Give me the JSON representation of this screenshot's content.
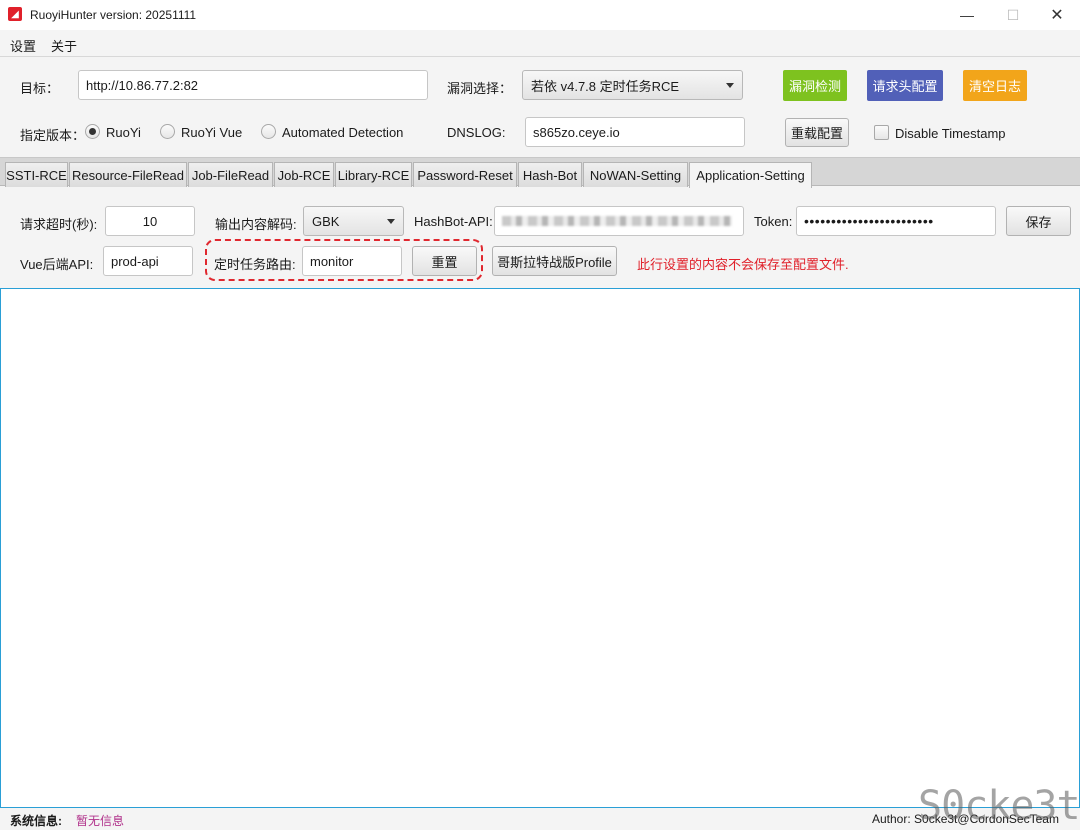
{
  "window": {
    "title": "RuoyiHunter version: 20251111",
    "minimize": "—",
    "maximize": "☐",
    "close": "✕"
  },
  "menu": {
    "items": [
      "设置",
      "关于"
    ]
  },
  "form": {
    "target_label": "目标：",
    "target_value": "http://10.86.77.2:82",
    "vuln_label": "漏洞选择：",
    "vuln_value": "若依 v4.7.8 定时任务RCE",
    "detect_btn": "漏洞检测",
    "header_btn": "请求头配置",
    "clear_btn": "清空日志",
    "version_label": "指定版本：",
    "version_options": [
      "RuoYi",
      "RuoYi Vue",
      "Automated Detection"
    ],
    "version_selected": 0,
    "dnslog_label": "DNSLOG:",
    "dnslog_value": "s865zo.ceye.io",
    "reload_btn": "重载配置",
    "disable_timestamp": "Disable Timestamp",
    "disable_timestamp_checked": false
  },
  "tabs": {
    "items": [
      "SSTI-RCE",
      "Resource-FileRead",
      "Job-FileRead",
      "Job-RCE",
      "Library-RCE",
      "Password-Reset",
      "Hash-Bot",
      "NoWAN-Setting",
      "Application-Setting"
    ],
    "active": 8
  },
  "settings": {
    "timeout_label": "请求超时(秒):",
    "timeout_value": "10",
    "encoding_label": "输出内容解码:",
    "encoding_value": "GBK",
    "hashbot_label": "HashBot-API:",
    "token_label": "Token:",
    "token_value": "••••••••••••••••••••••••",
    "save_btn": "保存",
    "vue_api_label": "Vue后端API:",
    "vue_api_value": "prod-api",
    "job_route_label": "定时任务路由:",
    "job_route_value": "monitor",
    "reset_btn": "重置",
    "profile_btn": "哥斯拉特战版Profile",
    "notice": "此行设置的内容不会保存至配置文件."
  },
  "status": {
    "label": "系统信息:",
    "value": "暂无信息",
    "author": "Author: S0cke3t@CordonSecTeam"
  },
  "watermark": "S0cke3t",
  "colors": {
    "detect": "#7ec21f",
    "header": "#5160b8",
    "clear": "#f2a51a",
    "notice": "#e0202a",
    "status_value": "#b0308a"
  }
}
